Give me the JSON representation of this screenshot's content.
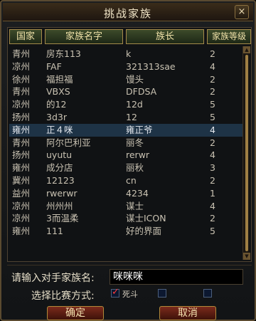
{
  "dialog": {
    "title": "挑战家族",
    "close_label": "×"
  },
  "columns": {
    "country": "国家",
    "family_name": "家族名字",
    "leader": "族长",
    "family_level": "家族等级"
  },
  "rows": [
    {
      "country": "青州",
      "name": "房东113",
      "leader": "k",
      "level": "2"
    },
    {
      "country": "凉州",
      "name": "FAF",
      "leader": "321313sae",
      "level": "4"
    },
    {
      "country": "徐州",
      "name": "福担福",
      "leader": "馒头",
      "level": "2"
    },
    {
      "country": "青州",
      "name": "VBXS",
      "leader": "DFDSA",
      "level": "2"
    },
    {
      "country": "凉州",
      "name": "的12",
      "leader": "12d",
      "level": "5"
    },
    {
      "country": "扬州",
      "name": "3d3r",
      "leader": "12",
      "level": "5"
    },
    {
      "country": "雍州",
      "name": "正４咪",
      "leader": "雍正爷",
      "level": "4"
    },
    {
      "country": "青州",
      "name": "阿尔巴利亚",
      "leader": "丽冬",
      "level": "2"
    },
    {
      "country": "扬州",
      "name": "uyutu",
      "leader": "rerwr",
      "level": "4"
    },
    {
      "country": "雍州",
      "name": "成分店",
      "leader": "丽秋",
      "level": "3"
    },
    {
      "country": "冀州",
      "name": "12123",
      "leader": "cn",
      "level": "2"
    },
    {
      "country": "益州",
      "name": "rwerwr",
      "leader": "4234",
      "level": "1"
    },
    {
      "country": "凉州",
      "name": "州州州",
      "leader": "谋士",
      "level": "4"
    },
    {
      "country": "凉州",
      "name": "3而温柔",
      "leader": "谋士ICON",
      "level": "2"
    },
    {
      "country": "雍州",
      "name": "111",
      "leader": "好的界面",
      "level": "5"
    }
  ],
  "selected_row": 6,
  "form": {
    "opponent_label": "请输入对手家族名:",
    "opponent_value": "咪咪咪",
    "mode_label": "选择比赛方式:",
    "options": [
      {
        "label": "死斗",
        "checked": true
      },
      {
        "label": "",
        "checked": false
      },
      {
        "label": "",
        "checked": false
      }
    ]
  },
  "buttons": {
    "confirm": "确定",
    "cancel": "取消"
  },
  "colors": {
    "accent": "#a48a4a",
    "selected_row": "#1e3346",
    "button": "#7a2a1c",
    "check": "#ff3a3a"
  }
}
